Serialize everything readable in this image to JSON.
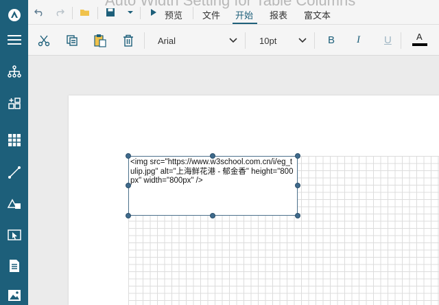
{
  "window": {
    "background_title": "Auto Width Setting for Table Columns"
  },
  "topbar": {
    "preview_label": "预览",
    "tabs": [
      {
        "label": "文件",
        "active": false
      },
      {
        "label": "开始",
        "active": true
      },
      {
        "label": "报表",
        "active": false
      },
      {
        "label": "富文本",
        "active": false
      }
    ]
  },
  "ribbon": {
    "font_family": "Arial",
    "font_size": "10pt",
    "bold_label": "B",
    "italic_label": "I",
    "underline_label": "U",
    "font_color_label": "A"
  },
  "rail": {
    "items": [
      {
        "name": "logo-icon"
      },
      {
        "name": "menu-icon"
      },
      {
        "name": "hierarchy-icon"
      },
      {
        "name": "add-grid-icon"
      },
      {
        "name": "table-icon"
      },
      {
        "name": "line-icon"
      },
      {
        "name": "shapes-icon"
      },
      {
        "name": "pointer-box-icon"
      },
      {
        "name": "document-icon"
      },
      {
        "name": "image-icon"
      }
    ]
  },
  "textbox": {
    "content": "<img src=\"https://www.w3school.com.cn/i/eg_tulip.jpg\" alt=\"上海鲜花港 - 郁金香\" height=\"800px\" width=\"800px\" />"
  },
  "colors": {
    "rail": "#1d5f7a",
    "accent": "#1d5f7a",
    "handle": "#3f6a8c",
    "font_color_bar": "#000000"
  }
}
